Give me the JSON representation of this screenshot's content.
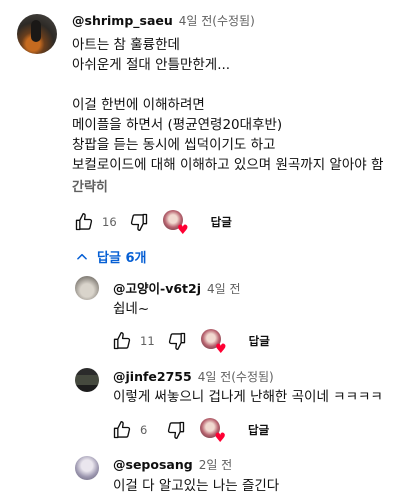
{
  "comment": {
    "author": "@shrimp_saeu",
    "time": "4일 전(수정됨)",
    "text": "아트는 참 훌륭한데\n아쉬운게 절대 안틀만한게...\n\n이걸 한번에 이해하려면\n메이플을 하면서 (평균연령20대후반)\n창팝을 듣는 동시에 씹덕이기도 하고\n보컬로이드에 대해 이해하고 있으며 원곡까지 알아야 함",
    "text_last": "간략히",
    "likes": "16",
    "reply_label": "답글"
  },
  "replies_toggle": {
    "label": "답글 6개",
    "icon": "chevron-up-icon",
    "color": "#065fd4"
  },
  "replies": [
    {
      "author": "@고양이-v6t2j",
      "time": "4일 전",
      "text": "쉽네~",
      "likes": "11",
      "reply_label": "답글"
    },
    {
      "author": "@jinfe2755",
      "time": "4일 전(수정됨)",
      "text": "이렇게 써놓으니 겁나게 난해한 곡이네 ㅋㅋㅋㅋ",
      "likes": "6",
      "reply_label": "답글"
    },
    {
      "author": "@seposang",
      "time": "2일 전",
      "text": "이걸 다 알고있는 나는 즐긴다"
    }
  ],
  "colors": {
    "heart": "#ff0033",
    "secondary_text": "#606060"
  }
}
